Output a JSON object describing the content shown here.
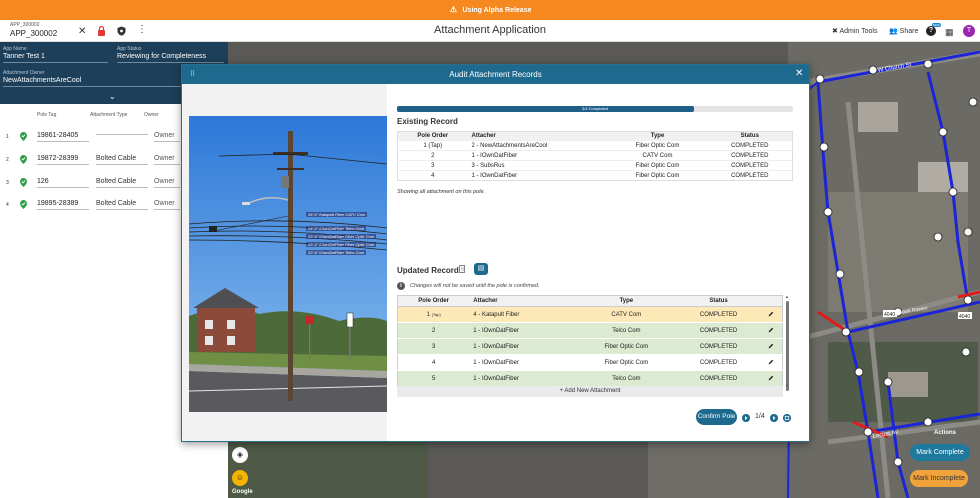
{
  "banner": {
    "text": "Using Alpha Release"
  },
  "header": {
    "app_id_label": "APP_300002",
    "app_id_value": "APP_300002",
    "title": "Attachment Application",
    "admin_tools": "Admin Tools",
    "share": "Share",
    "help_badge": "NEW",
    "avatar_initial": "T"
  },
  "left_panel": {
    "app_name_label": "App Name",
    "app_name": "Tanner Test 1",
    "app_status_label": "App Status",
    "app_status": "Reviewing for Completeness",
    "owner_label": "Attachment Owner",
    "owner": "NewAttachmentsAreCool",
    "columns": [
      "Pole Tag",
      "Attachment Type",
      "Owner"
    ],
    "rows": [
      {
        "num": "1",
        "tag": "19861-28405",
        "type": "",
        "owner": "Owner"
      },
      {
        "num": "2",
        "tag": "19872-28399",
        "type": "Bolted Cable",
        "owner": "Owner"
      },
      {
        "num": "3",
        "tag": "126",
        "type": "Bolted Cable",
        "owner": "Owner"
      },
      {
        "num": "4",
        "tag": "19895-28389",
        "type": "Bolted Cable",
        "owner": "Owner"
      }
    ]
  },
  "map": {
    "labels": [
      "W Church St",
      "Mark Rowen",
      "Locust Av",
      "4040",
      "4040"
    ],
    "google": "Google",
    "actions": "Actions",
    "mark_complete": "Mark Complete",
    "mark_incomplete": "Mark Incomplete"
  },
  "dialog": {
    "title": "Audit Attachment Records",
    "progress": {
      "label": "3/4 Completed",
      "fraction": 0.75
    },
    "photo_labels": [
      "26'-0\" Katapult Fiber CATV Com",
      "24'-0\" IOwnDatFiber Telco Com",
      "23'-6\" IOwnDatFiber Fiber Optic Com",
      "23'-0\" IOwnDatFiber Fiber Optic Com",
      "22'-6\" IOwnDatFiber Telco Com"
    ],
    "existing": {
      "title": "Existing Record",
      "columns": [
        "Pole Order",
        "Attacher",
        "Type",
        "Status"
      ],
      "rows": [
        {
          "order": "1 (Tap)",
          "attacher": "2 - NewAttachmentsAreCool",
          "type": "Fiber Optic Com",
          "status": "COMPLETED"
        },
        {
          "order": "2",
          "attacher": "1 - IOwnDatFiber",
          "type": "CATV Com",
          "status": "COMPLETED"
        },
        {
          "order": "3",
          "attacher": "3 - SubsRus",
          "type": "Fiber Optic Com",
          "status": "COMPLETED"
        },
        {
          "order": "4",
          "attacher": "1 - IOwnDatFiber",
          "type": "Fiber Optic Com",
          "status": "COMPLETED"
        }
      ],
      "note": "Showing all attachment on this pole."
    },
    "updated": {
      "title": "Updated Record",
      "info": "Changes will not be saved until the pole is confirmed.",
      "columns": [
        "Pole Order",
        "Attacher",
        "Type",
        "Status"
      ],
      "rows": [
        {
          "order": "1",
          "tap": "(Tap)",
          "attacher": "4 - Katapult Fiber",
          "type": "CATV Com",
          "status": "COMPLETED",
          "style": "yellow"
        },
        {
          "order": "2",
          "tap": "",
          "attacher": "1 - IOwnDatFiber",
          "type": "Telco Com",
          "status": "COMPLETED",
          "style": "green"
        },
        {
          "order": "3",
          "tap": "",
          "attacher": "1 - IOwnDatFiber",
          "type": "Fiber Optic Com",
          "status": "COMPLETED",
          "style": "green"
        },
        {
          "order": "4",
          "tap": "",
          "attacher": "1 - IOwnDatFiber",
          "type": "Fiber Optic Com",
          "status": "COMPLETED",
          "style": "white"
        },
        {
          "order": "5",
          "tap": "",
          "attacher": "1 - IOwnDatFiber",
          "type": "Telco Com",
          "status": "COMPLETED",
          "style": "green"
        }
      ],
      "add_label": "Add New Attachment"
    },
    "confirm_label": "Confirm Pole",
    "page_indicator": "1/4"
  },
  "colors": {
    "banner": "#f5891f",
    "dialog_header": "#1e6a8e",
    "left_panel": "#1d3f59",
    "row_yellow": "#fde9b8",
    "row_green": "#dbead0",
    "map_route": "#1c25d6",
    "map_alert": "#e01b1b"
  }
}
